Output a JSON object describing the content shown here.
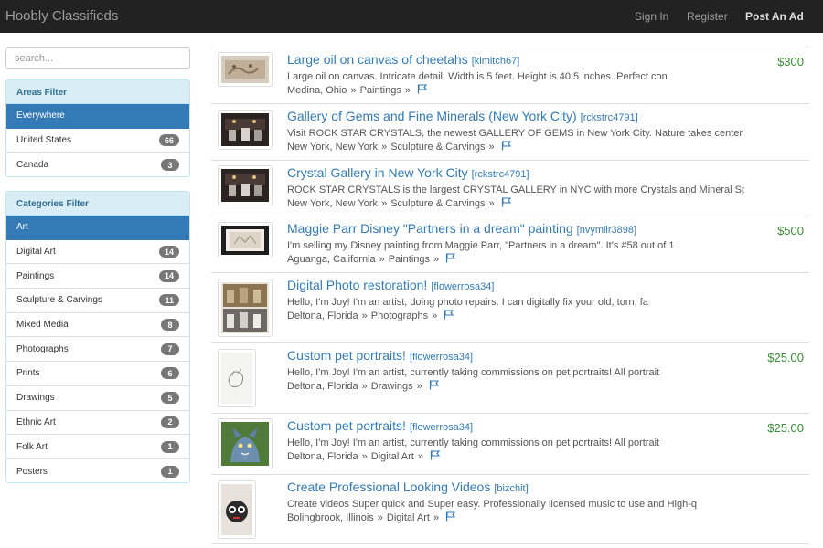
{
  "navbar": {
    "brand": "Hoobly Classifieds",
    "links": {
      "signin": "Sign In",
      "register": "Register",
      "post": "Post An Ad"
    }
  },
  "search": {
    "placeholder": "search..."
  },
  "areas": {
    "heading": "Areas Filter",
    "items": [
      {
        "label": "Everywhere",
        "count": ""
      },
      {
        "label": "United States",
        "count": "66"
      },
      {
        "label": "Canada",
        "count": "3"
      }
    ]
  },
  "categories": {
    "heading": "Categories Filter",
    "items": [
      {
        "label": "Art",
        "count": ""
      },
      {
        "label": "Digital Art",
        "count": "14"
      },
      {
        "label": "Paintings",
        "count": "14"
      },
      {
        "label": "Sculpture & Carvings",
        "count": "11"
      },
      {
        "label": "Mixed Media",
        "count": "8"
      },
      {
        "label": "Photographs",
        "count": "7"
      },
      {
        "label": "Prints",
        "count": "6"
      },
      {
        "label": "Drawings",
        "count": "5"
      },
      {
        "label": "Ethnic Art",
        "count": "2"
      },
      {
        "label": "Folk Art",
        "count": "1"
      },
      {
        "label": "Posters",
        "count": "1"
      }
    ]
  },
  "listings": [
    {
      "title": "Large oil on canvas of cheetahs",
      "user": "[klmitch67]",
      "desc": "Large oil on canvas. Intricate detail. Width is 5 feet. Height is 40.5 inches. Perfect con",
      "location": "Medina, Ohio",
      "category": "Paintings",
      "price": "$300"
    },
    {
      "title": "Gallery of Gems and Fine Minerals (New York City)",
      "user": "[rckstrc4791]",
      "desc": "Visit ROCK STAR CRYSTALS, the newest GALLERY OF GEMS in New York City. Nature takes center",
      "location": "New York, New York",
      "category": "Sculpture & Carvings",
      "price": ""
    },
    {
      "title": "Crystal Gallery in New York City",
      "user": "[rckstrc4791]",
      "desc": "ROCK STAR CRYSTALS is the largest CRYSTAL GALLERY in NYC with more Crystals and Mineral Sp",
      "location": "New York, New York",
      "category": "Sculpture & Carvings",
      "price": ""
    },
    {
      "title": "Maggie Parr Disney \"Partners in a dream\" painting",
      "user": "[nvymllr3898]",
      "desc": "I'm selling my Disney painting from Maggie Parr, \"Partners in a dream\". It's #58 out of 1",
      "location": "Aguanga, California",
      "category": "Paintings",
      "price": "$500"
    },
    {
      "title": "Digital Photo restoration!",
      "user": "[flowerrosa34]",
      "desc": "Hello, I'm Joy! I'm an artist, doing photo repairs. I can digitally fix your old, torn, fa",
      "location": "Deltona, Florida",
      "category": "Photographs",
      "price": ""
    },
    {
      "title": "Custom pet portraits!",
      "user": "[flowerrosa34]",
      "desc": "Hello, I'm Joy! I'm an artist, currently taking commissions on pet portraits! All portrait",
      "location": "Deltona, Florida",
      "category": "Drawings",
      "price": "$25.00"
    },
    {
      "title": "Custom pet portraits!",
      "user": "[flowerrosa34]",
      "desc": "Hello, I'm Joy! I'm an artist, currently taking commissions on pet portraits! All portrait",
      "location": "Deltona, Florida",
      "category": "Digital Art",
      "price": "$25.00"
    },
    {
      "title": "Create Professional Looking Videos",
      "user": "[bizchit]",
      "desc": "Create videos Super quick and Super easy. Professionally licensed music to use and High-q",
      "location": "Bolingbrook, Illinois",
      "category": "Digital Art",
      "price": ""
    }
  ],
  "separator": "»"
}
